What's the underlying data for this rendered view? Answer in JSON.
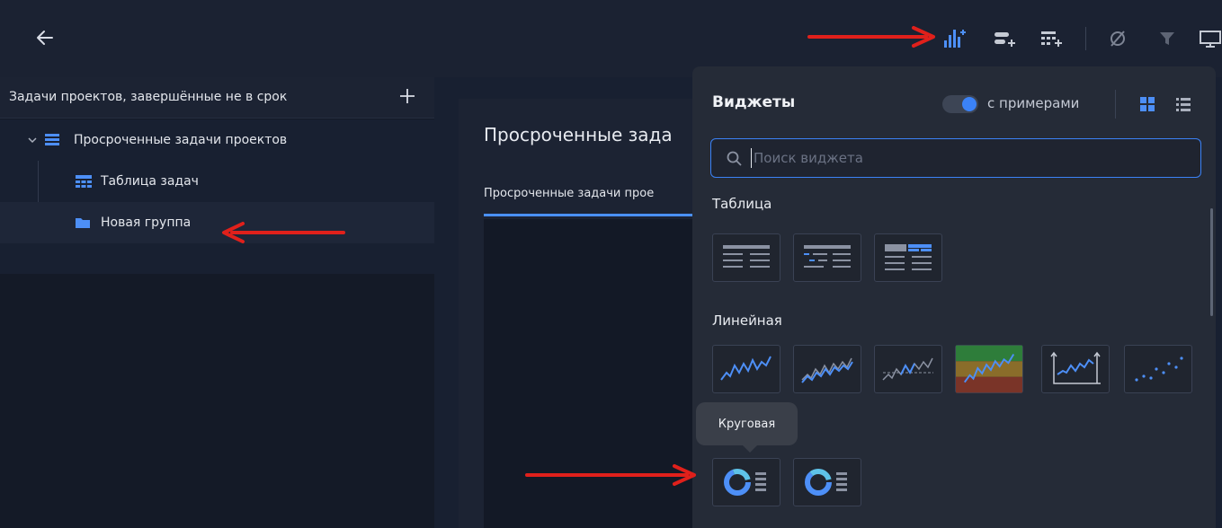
{
  "tree": {
    "title": "Задачи проектов, завершённые не в срок",
    "items": [
      {
        "label": "Просроченные задачи проектов"
      },
      {
        "label": "Таблица задач"
      },
      {
        "label": "Новая группа"
      }
    ]
  },
  "dashboard": {
    "title": "Просроченные зада",
    "tab": "Просроченные задачи прое"
  },
  "widgets": {
    "title": "Виджеты",
    "toggle_label": "с примерами",
    "toggle_on": true,
    "search_placeholder": "Поиск виджета",
    "sections": {
      "table": "Таблица",
      "line": "Линейная"
    },
    "tooltip": "Круговая"
  },
  "colors": {
    "accent": "#3b82f6",
    "annotation": "#e0201b"
  }
}
